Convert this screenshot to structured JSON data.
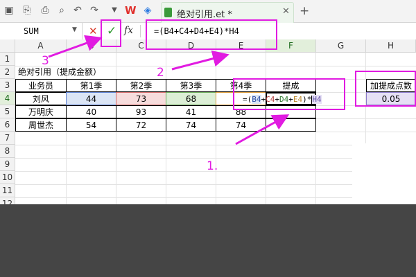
{
  "toolbar": {
    "icons": [
      "save-icon",
      "undo-icon",
      "redo-icon",
      "print-icon",
      "print-preview-icon",
      "dropdown-icon"
    ],
    "tab_label": "绝对引用.et *",
    "tab_close": "✕",
    "new_tab": "+"
  },
  "formula_bar": {
    "name_box": "SUM",
    "fx": "fx",
    "input": "=(B4+C4+D4+E4)*H4"
  },
  "columns": [
    "A",
    "B",
    "C",
    "D",
    "E",
    "F",
    "G",
    "H"
  ],
  "rows": [
    "1",
    "2",
    "3",
    "4",
    "5",
    "6",
    "7",
    "8",
    "9",
    "10",
    "11",
    "12"
  ],
  "sheet": {
    "title": "绝对引用（提成金额）",
    "headers": [
      "业务员",
      "第1季",
      "第2季",
      "第3季",
      "第4季",
      "提成"
    ],
    "rate_label": "加提成点数",
    "rate_value": "0.05",
    "data": [
      [
        "刘风",
        "44",
        "73",
        "68",
        "",
        ""
      ],
      [
        "万明庆",
        "40",
        "93",
        "41",
        "88",
        ""
      ],
      [
        "周世杰",
        "54",
        "72",
        "74",
        "74",
        ""
      ]
    ],
    "formula_parts": {
      "open": "=(",
      "b": "B4",
      "plus1": "+",
      "c": "C4",
      "plus2": "+",
      "d": "D4",
      "plus3": "+",
      "e": "E4",
      "close": ")*",
      "h": "H4"
    }
  },
  "annotations": {
    "one": "1.",
    "two": "2",
    "three": "3",
    "color": "#e11be1"
  }
}
